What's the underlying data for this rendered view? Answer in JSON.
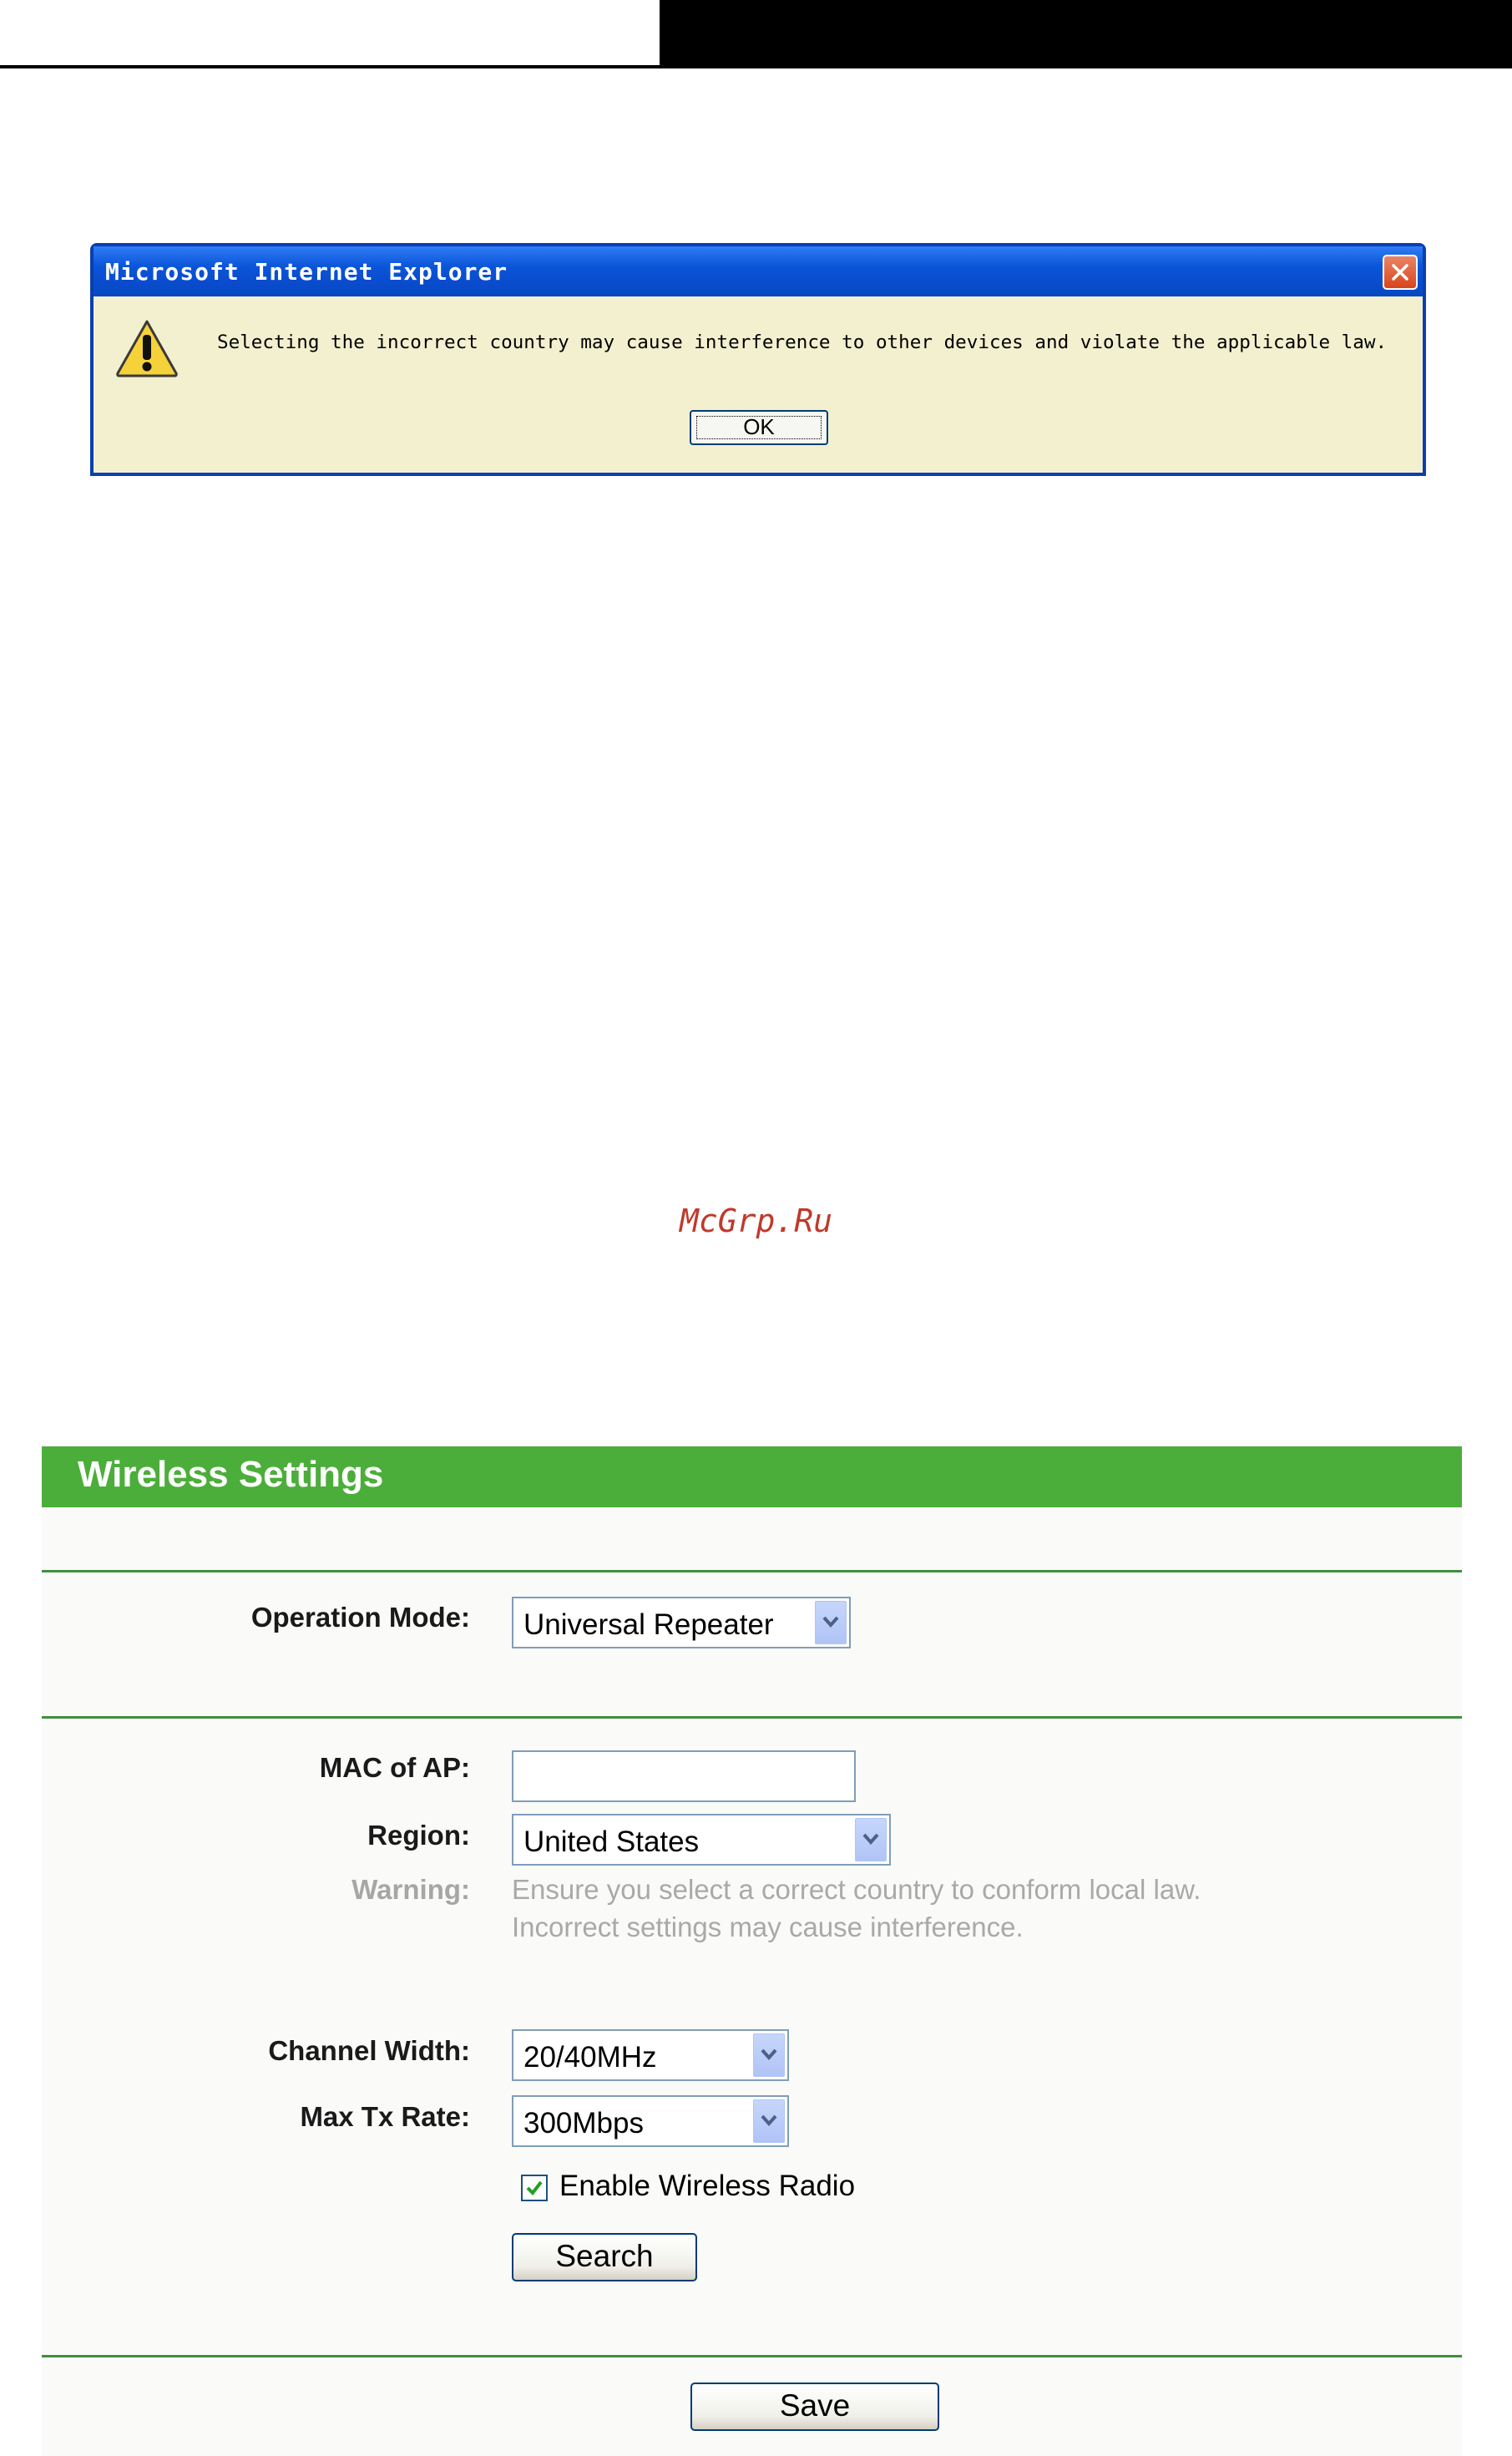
{
  "dialog": {
    "title": "Microsoft Internet Explorer",
    "message": "Selecting the incorrect country may cause interference to other devices and violate the applicable law.",
    "ok_label": "OK"
  },
  "watermark": "McGrp.Ru",
  "panel": {
    "title": "Wireless Settings",
    "operation_mode": {
      "label": "Operation Mode:",
      "value": "Universal Repeater"
    },
    "mac_of_ap": {
      "label": "MAC of AP:",
      "value": ""
    },
    "region": {
      "label": "Region:",
      "value": "United States"
    },
    "warning": {
      "label": "Warning:",
      "line1": "Ensure you select a correct country to conform local law.",
      "line2": "Incorrect settings may cause interference."
    },
    "channel_width": {
      "label": "Channel Width:",
      "value": "20/40MHz"
    },
    "max_tx_rate": {
      "label": "Max Tx Rate:",
      "value": "300Mbps"
    },
    "enable_wireless_radio": {
      "label": "Enable Wireless Radio",
      "checked": true
    },
    "search_label": "Search",
    "save_label": "Save"
  },
  "colors": {
    "panel_header": "#4cae3a",
    "separator": "#3f8f3f",
    "dialog_titlebar": "#0a55d8",
    "watermark": "#c0392b"
  }
}
